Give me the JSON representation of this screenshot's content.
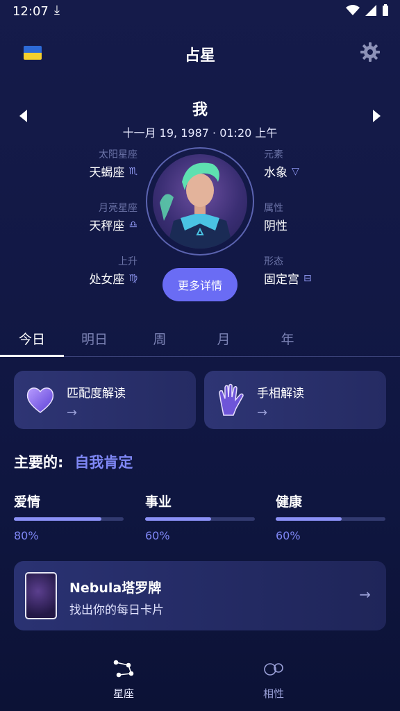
{
  "status_bar": {
    "time": "12:07"
  },
  "header": {
    "title": "占星"
  },
  "profile": {
    "name": "我",
    "birth": "十一月 19, 1987 · 01:20 上午",
    "left": [
      {
        "label": "太阳星座",
        "value": "天蝎座",
        "glyph": "♏"
      },
      {
        "label": "月亮星座",
        "value": "天秤座",
        "glyph": "♎"
      },
      {
        "label": "上升",
        "value": "处女座",
        "glyph": "♍"
      }
    ],
    "right": [
      {
        "label": "元素",
        "value": "水象",
        "glyph": "▽"
      },
      {
        "label": "属性",
        "value": "阴性",
        "glyph": ""
      },
      {
        "label": "形态",
        "value": "固定宫",
        "glyph": "⊟"
      }
    ],
    "more_button": "更多详情"
  },
  "tabs": [
    "今日",
    "明日",
    "周",
    "月",
    "年"
  ],
  "cards": [
    {
      "title": "匹配度解读",
      "arrow": "→"
    },
    {
      "title": "手相解读",
      "arrow": "→"
    }
  ],
  "main": {
    "label": "主要的:",
    "value": "自我肯定"
  },
  "metrics": [
    {
      "name": "爱情",
      "percent": 80,
      "percent_label": "80%"
    },
    {
      "name": "事业",
      "percent": 60,
      "percent_label": "60%"
    },
    {
      "name": "健康",
      "percent": 60,
      "percent_label": "60%"
    }
  ],
  "tarot": {
    "title": "Nebula塔罗牌",
    "subtitle": "找出你的每日卡片",
    "arrow": "→"
  },
  "bottom_nav": [
    {
      "label": "星座"
    },
    {
      "label": "相性"
    }
  ],
  "colors": {
    "accent": "#6a6cf4",
    "accent_text": "#7f87f5",
    "background": "#131947"
  }
}
